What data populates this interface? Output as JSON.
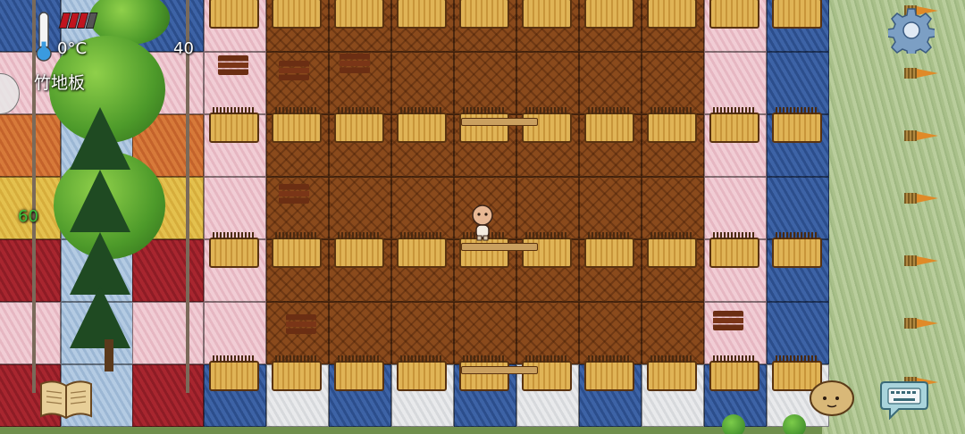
{
  "hud": {
    "temperature": "0°C",
    "counter": "40",
    "selected_item": "竹地板",
    "fps": "60",
    "thermometer_level": 0.15,
    "health_bars": 3,
    "health_bars_total": 4
  },
  "colors": {
    "fps_text": "#3cc23c",
    "health_bar": "#c0141e",
    "floor_wood": "#8a4a1c",
    "tile_pink": "#e6b7c2",
    "tile_blue": "#2c4e8c"
  },
  "icons": {
    "thermometer": "thermometer-icon",
    "settings": "gear-icon",
    "journal": "open-book-icon",
    "chat": "keyboard-chat-icon",
    "companion": "potato-icon"
  }
}
